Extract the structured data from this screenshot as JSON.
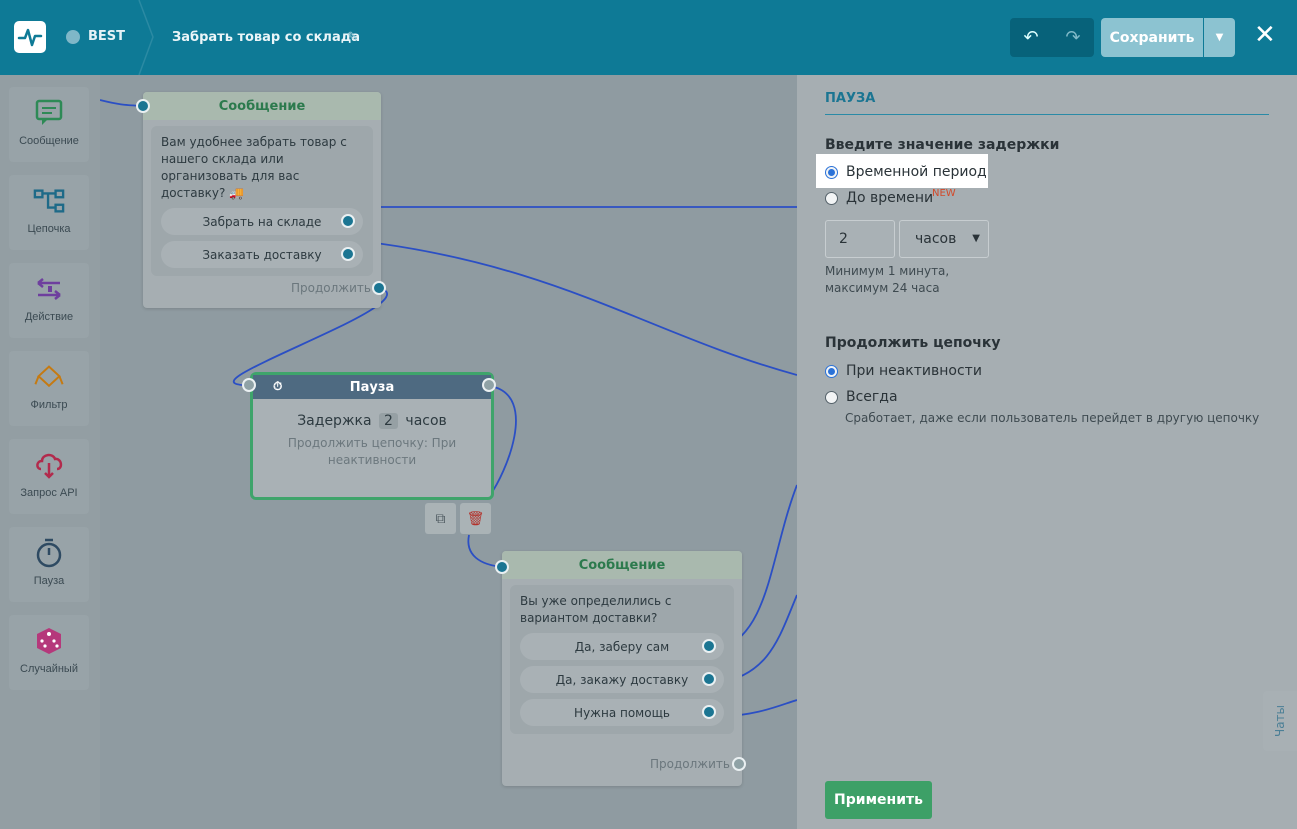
{
  "header": {
    "bot_name": "BEST",
    "flow_title": "Забрать товар со склада",
    "save_label": "Сохранить",
    "icons": [
      "logo-pulse-icon",
      "messenger-icon",
      "pencil-icon",
      "undo-icon",
      "redo-icon",
      "caret-down-icon",
      "close-icon"
    ]
  },
  "toolbox": {
    "items": [
      {
        "label": "Сообщение",
        "icon": "message-icon"
      },
      {
        "label": "Цепочка",
        "icon": "chain-icon"
      },
      {
        "label": "Действие",
        "icon": "action-icon"
      },
      {
        "label": "Фильтр",
        "icon": "filter-icon"
      },
      {
        "label": "Запрос API",
        "icon": "api-icon"
      },
      {
        "label": "Пауза",
        "icon": "stopwatch-icon"
      },
      {
        "label": "Случайный",
        "icon": "dice-icon"
      }
    ]
  },
  "nodes": {
    "message1": {
      "title": "Сообщение",
      "text": "Вам удобнее забрать товар с нашего склада или организовать для вас доставку? 🚚",
      "buttons": [
        "Забрать на складе",
        "Заказать доставку"
      ],
      "continue_label": "Продолжить"
    },
    "pause": {
      "title": "Пауза",
      "delay_prefix": "Задержка",
      "delay_value": "2",
      "delay_unit": "часов",
      "continue_text": "Продолжить цепочку: При неактивности"
    },
    "message2": {
      "title": "Сообщение",
      "text": "Вы уже определились с вариантом доставки?",
      "buttons": [
        "Да, заберу сам",
        "Да, закажу доставку",
        "Нужна помощь"
      ],
      "continue_label": "Продолжить"
    }
  },
  "panel": {
    "title": "ПАУЗА",
    "delay_heading": "Введите значение задержки",
    "delay_options": [
      {
        "label": "Временной период",
        "selected": true
      },
      {
        "label": "До времени",
        "selected": false,
        "badge": "NEW"
      }
    ],
    "amount_value": "2",
    "unit_value": "часов",
    "hint_line1": "Минимум 1 минута,",
    "hint_line2": "максимум 24 часа",
    "continue_heading": "Продолжить цепочку",
    "continue_options": [
      {
        "label": "При неактивности",
        "selected": true
      },
      {
        "label": "Всегда",
        "selected": false
      }
    ],
    "always_hint": "Сработает, даже если пользователь перейдет в другую цепочку",
    "apply_label": "Применить",
    "chats_label": "Чаты"
  },
  "colors": {
    "header_bg": "#0e7a96",
    "accent": "#1b7592",
    "apply": "#3da067",
    "radio": "#2b72d8",
    "new_badge": "#d24a2a"
  }
}
